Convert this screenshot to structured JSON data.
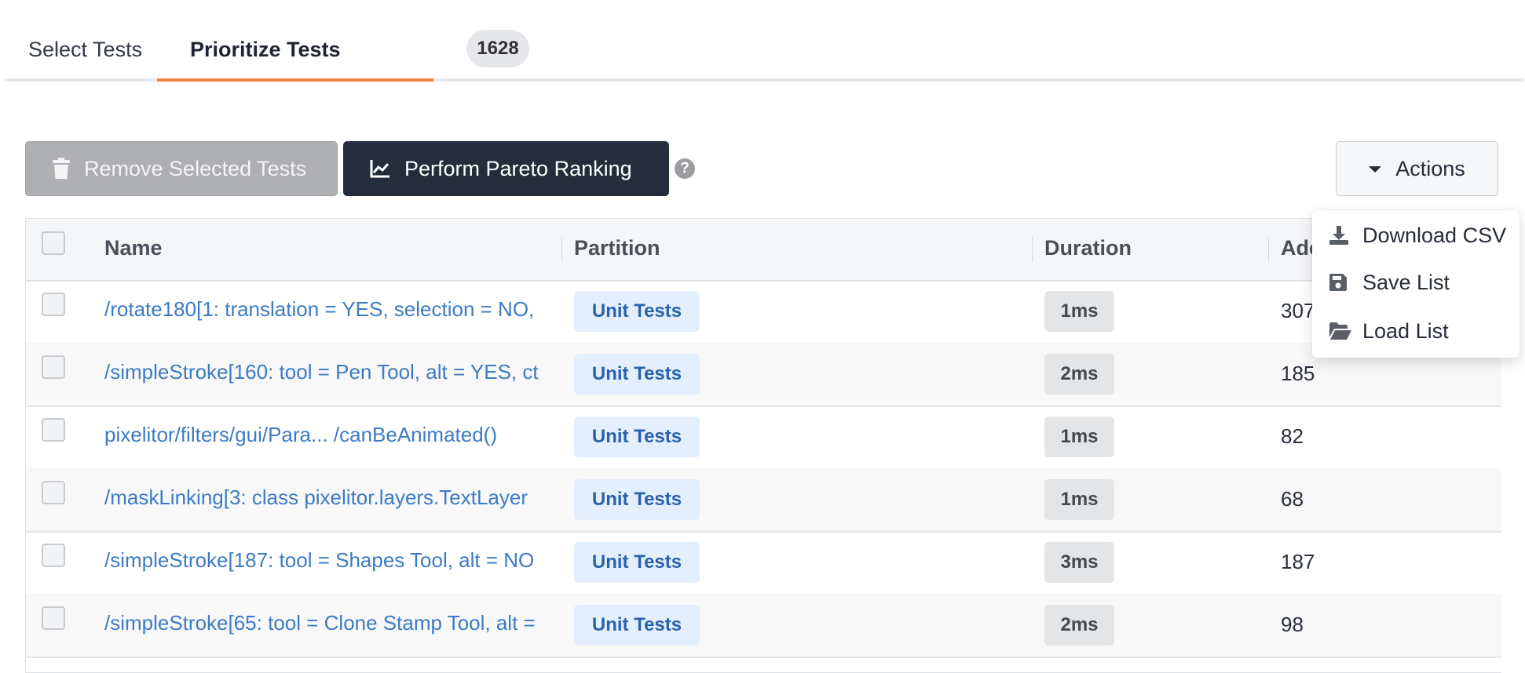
{
  "tabs": [
    {
      "label": "Select Tests"
    },
    {
      "label": "Prioritize Tests",
      "count": "1628"
    }
  ],
  "toolbar": {
    "remove_label": "Remove Selected Tests",
    "pareto_label": "Perform Pareto Ranking",
    "help_glyph": "?",
    "actions_label": "Actions"
  },
  "table": {
    "headers": {
      "name": "Name",
      "partition": "Partition",
      "duration": "Duration",
      "added": "Ade"
    },
    "rows": [
      {
        "name": "/rotate180[1: translation = YES, selection = NO,",
        "partition": "Unit Tests",
        "duration": "1ms",
        "added": "307"
      },
      {
        "name": "/simpleStroke[160: tool = Pen Tool, alt = YES, ct",
        "partition": "Unit Tests",
        "duration": "2ms",
        "added": "185"
      },
      {
        "name": "pixelitor/filters/gui/Para...  /canBeAnimated()",
        "partition": "Unit Tests",
        "duration": "1ms",
        "added": "82"
      },
      {
        "name": "/maskLinking[3: class pixelitor.layers.TextLayer",
        "partition": "Unit Tests",
        "duration": "1ms",
        "added": "68"
      },
      {
        "name": "/simpleStroke[187: tool = Shapes Tool, alt = NO",
        "partition": "Unit Tests",
        "duration": "3ms",
        "added": "187"
      },
      {
        "name": "/simpleStroke[65: tool = Clone Stamp Tool, alt =",
        "partition": "Unit Tests",
        "duration": "2ms",
        "added": "98"
      }
    ]
  },
  "actions_menu": {
    "items": [
      {
        "label": "Download CSV",
        "icon": "download-icon"
      },
      {
        "label": "Save List",
        "icon": "save-icon"
      },
      {
        "label": "Load List",
        "icon": "folder-open-icon"
      }
    ]
  },
  "colors": {
    "accent_tab_underline": "#f08443",
    "primary_button": "#252d3c",
    "link": "#3c7bc4",
    "partition_badge_bg": "#e3effc"
  }
}
